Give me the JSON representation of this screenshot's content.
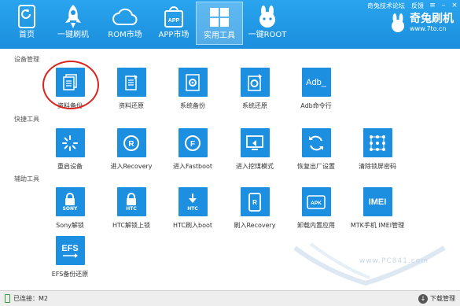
{
  "top_links": {
    "forum": "奇兔技术论坛",
    "feedback": "反馈"
  },
  "nav": [
    {
      "label": "首页",
      "icon": "refresh-phone-icon"
    },
    {
      "label": "一键刷机",
      "icon": "rocket-icon"
    },
    {
      "label": "ROM市场",
      "icon": "cloud-icon"
    },
    {
      "label": "APP市场",
      "icon": "shopping-bag-icon"
    },
    {
      "label": "实用工具",
      "icon": "grid-icon"
    },
    {
      "label": "一键ROOT",
      "icon": "rabbit-icon"
    }
  ],
  "brand": {
    "name": "奇兔刷机",
    "url": "www.7to.cn"
  },
  "sections": {
    "device": "设备管理",
    "quick": "快捷工具",
    "aux": "辅助工具"
  },
  "device_tools": [
    "资料备份",
    "资料还原",
    "系统备份",
    "系统还原",
    "Adb命令行"
  ],
  "quick_tools": [
    "重启设备",
    "进入Recovery",
    "进入Fastboot",
    "进入挖煤模式",
    "恢复出厂设置",
    "清除锁屏密码"
  ],
  "aux_tools": [
    "Sony解锁",
    "HTC解锁上锁",
    "HTC刷入boot",
    "刷入Recovery",
    "卸载内置应用",
    "MTK手机 IMEI管理",
    "EFS备份还原"
  ],
  "tile_texts": {
    "adb": "Adb_",
    "sony": "SONY",
    "htc": "HTC",
    "apk": "APK",
    "imei": "IMEI",
    "efs": "EFS",
    "r": "R",
    "f": "F"
  },
  "watermark": "www.PC841.com",
  "status": {
    "connected": "已连接：M2",
    "download": "下载管理"
  },
  "colors": {
    "header": "#1e94e4",
    "tile": "#1d8fe0",
    "highlight": "#d9231c"
  }
}
